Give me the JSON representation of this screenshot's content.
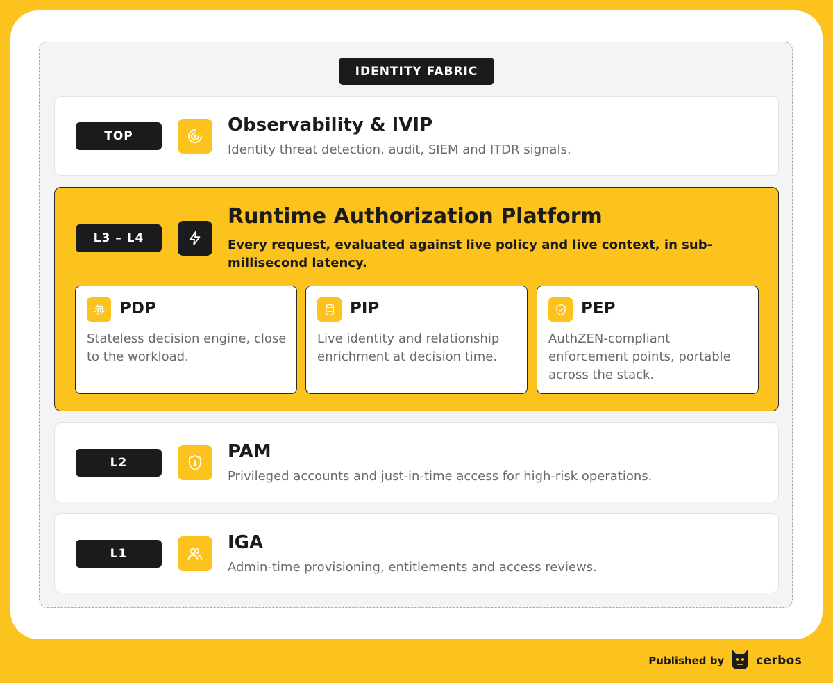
{
  "fabric": {
    "title": "IDENTITY FABRIC"
  },
  "layers": [
    {
      "badge": "TOP",
      "icon": "radar-icon",
      "title": "Observability & IVIP",
      "description": "Identity threat detection, audit, SIEM and ITDR signals."
    },
    {
      "badge": "L3 – L4",
      "icon": "lightning-icon",
      "title": "Runtime Authorization Platform",
      "description": "Every request, evaluated against live policy and live context, in sub-millisecond latency.",
      "components": [
        {
          "icon": "chip-icon",
          "title": "PDP",
          "description": "Stateless decision engine, close to the workload."
        },
        {
          "icon": "database-icon",
          "title": "PIP",
          "description": "Live identity and relationship enrichment at decision time."
        },
        {
          "icon": "shield-check-icon",
          "title": "PEP",
          "description": "AuthZEN-compliant enforcement points, portable across the stack."
        }
      ]
    },
    {
      "badge": "L2",
      "icon": "shield-lock-icon",
      "title": "PAM",
      "description": "Privileged accounts and just-in-time access for high-risk operations."
    },
    {
      "badge": "L1",
      "icon": "users-icon",
      "title": "IGA",
      "description": "Admin-time provisioning, entitlements and access reviews."
    }
  ],
  "footer": {
    "published_by": "Published by",
    "brand": "cerbos",
    "logo_icon": "cerbos-logo-icon"
  },
  "colors": {
    "accent": "#fcc21e",
    "dark": "#1b1b1d",
    "muted_text": "#6a6a6a"
  }
}
